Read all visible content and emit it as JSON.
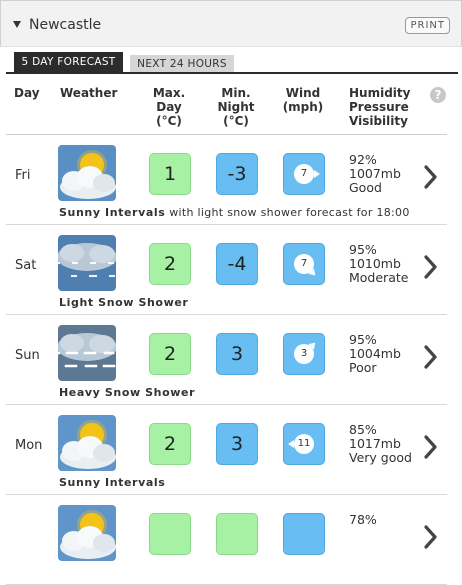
{
  "header": {
    "city": "Newcastle",
    "print_label": "PRINT"
  },
  "tabs": {
    "active": "5 DAY FORECAST",
    "inactive": "NEXT 24 HOURS"
  },
  "columns": {
    "day": "Day",
    "weather": "Weather",
    "max_line1": "Max.",
    "max_line2": "Day",
    "max_line3": "(°C)",
    "min_line1": "Min.",
    "min_line2": "Night",
    "min_line3": "(°C)",
    "wind_line1": "Wind",
    "wind_line2": "(mph)",
    "hum_line1": "Humidity",
    "hum_line2": "Pressure",
    "hum_line3": "Visibility",
    "help": "?"
  },
  "rows": [
    {
      "day": "Fri",
      "icon": "sunny-intervals-snow-icon",
      "max": "1",
      "min": "-3",
      "wind": "7",
      "wind_dir": "west",
      "humidity": "92%",
      "pressure": "1007mb",
      "visibility": "Good",
      "desc_bold": "Sunny Intervals",
      "desc_rest": " with light snow shower forecast for 18:00"
    },
    {
      "day": "Sat",
      "icon": "light-snow-shower-icon",
      "max": "2",
      "min": "-4",
      "wind": "7",
      "wind_dir": "northwest",
      "humidity": "95%",
      "pressure": "1010mb",
      "visibility": "Moderate",
      "desc_bold": "Light Snow Shower",
      "desc_rest": ""
    },
    {
      "day": "Sun",
      "icon": "heavy-snow-shower-icon",
      "max": "2",
      "min": "3",
      "wind": "3",
      "wind_dir": "southwest",
      "humidity": "95%",
      "pressure": "1004mb",
      "visibility": "Poor",
      "desc_bold": "Heavy Snow Shower",
      "desc_rest": ""
    },
    {
      "day": "Mon",
      "icon": "sunny-intervals-icon",
      "max": "2",
      "min": "3",
      "wind": "11",
      "wind_dir": "east",
      "humidity": "85%",
      "pressure": "1017mb",
      "visibility": "Very good",
      "desc_bold": "Sunny Intervals",
      "desc_rest": ""
    },
    {
      "day": "",
      "icon": "sunny-intervals-icon",
      "max": "",
      "min": "",
      "wind": "",
      "wind_dir": "",
      "humidity": "78%",
      "pressure": "",
      "visibility": "",
      "desc_bold": "",
      "desc_rest": ""
    }
  ]
}
